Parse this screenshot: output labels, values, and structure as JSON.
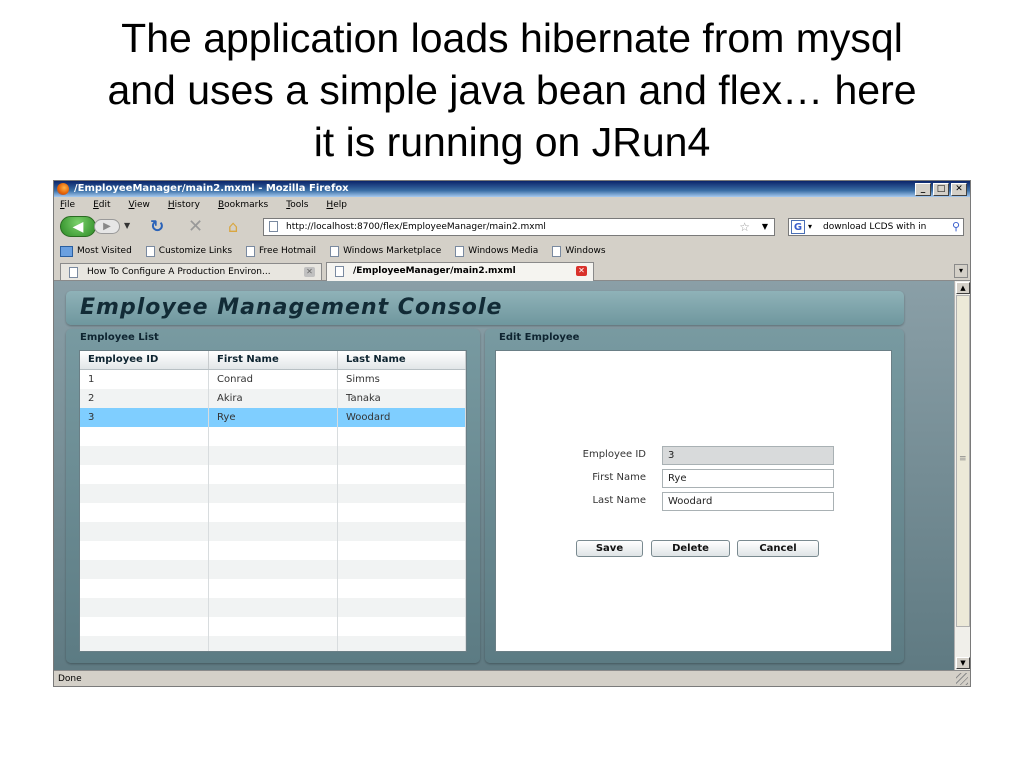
{
  "slide": {
    "title_line1": "The application loads hibernate from mysql",
    "title_line2": "and uses a simple java bean and flex… here",
    "title_line3": "it is running on JRun4"
  },
  "browser": {
    "window_title": "/EmployeeManager/main2.mxml - Mozilla Firefox",
    "menu": [
      "File",
      "Edit",
      "View",
      "History",
      "Bookmarks",
      "Tools",
      "Help"
    ],
    "url": "http://localhost:8700/flex/EmployeeManager/main2.mxml",
    "search_value": "download LCDS with in",
    "bookmarks": [
      "Most Visited",
      "Customize Links",
      "Free Hotmail",
      "Windows Marketplace",
      "Windows Media",
      "Windows"
    ],
    "tabs": [
      {
        "label": "How To Configure A Production Environ...",
        "active": false
      },
      {
        "label": "/EmployeeManager/main2.mxml",
        "active": true
      }
    ],
    "status": "Done"
  },
  "app": {
    "header_title": "Employee Management Console",
    "list_panel": {
      "title": "Employee List",
      "columns": [
        "Employee ID",
        "First Name",
        "Last Name"
      ],
      "rows": [
        [
          "1",
          "Conrad",
          "Simms"
        ],
        [
          "2",
          "Akira",
          "Tanaka"
        ],
        [
          "3",
          "Rye",
          "Woodard"
        ]
      ],
      "selected_index": 2
    },
    "edit_panel": {
      "title": "Edit Employee",
      "employee_id_label": "Employee ID",
      "employee_id_value": "3",
      "first_name_label": "First Name",
      "first_name_value": "Rye",
      "last_name_label": "Last Name",
      "last_name_value": "Woodard",
      "save_label": "Save",
      "delete_label": "Delete",
      "cancel_label": "Cancel"
    }
  },
  "colors": {
    "selected_row": "#7fceff",
    "panel_bg": "#6f8f96",
    "header_text": "#122b36"
  }
}
